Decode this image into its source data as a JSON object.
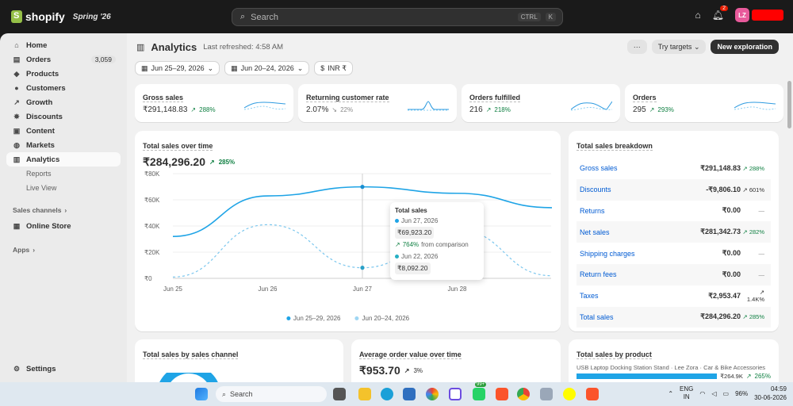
{
  "topbar": {
    "brand": "shopify",
    "edition": "Spring '26",
    "search_placeholder": "Search",
    "kbd_ctrl": "CTRL",
    "kbd_k": "K",
    "notif_count": "2",
    "avatar_initials": "LZ"
  },
  "sidebar": {
    "items": [
      {
        "label": "Home",
        "icon": "home-icon"
      },
      {
        "label": "Orders",
        "icon": "orders-icon",
        "count": "3,059"
      },
      {
        "label": "Products",
        "icon": "tag-icon"
      },
      {
        "label": "Customers",
        "icon": "person-icon"
      },
      {
        "label": "Growth",
        "icon": "growth-icon"
      },
      {
        "label": "Discounts",
        "icon": "discount-icon"
      },
      {
        "label": "Content",
        "icon": "content-icon"
      },
      {
        "label": "Markets",
        "icon": "globe-icon"
      },
      {
        "label": "Analytics",
        "icon": "chart-icon"
      }
    ],
    "subitems": [
      "Reports",
      "Live View"
    ],
    "sales_channels": "Sales channels",
    "online_store": "Online Store",
    "apps": "Apps",
    "settings": "Settings"
  },
  "header": {
    "title": "Analytics",
    "refreshed": "Last refreshed: 4:58 AM",
    "more": "···",
    "try_targets": "Try targets",
    "new_exploration": "New exploration"
  },
  "filters": {
    "date1": "Jun 25–29, 2026",
    "date2": "Jun 20–24, 2026",
    "currency": "INR ₹"
  },
  "kpis": [
    {
      "title": "Gross sales",
      "value": "₹291,148.83",
      "change": "288%",
      "trend": "up"
    },
    {
      "title": "Returning customer rate",
      "value": "2.07%",
      "change": "22%",
      "trend": "down"
    },
    {
      "title": "Orders fulfilled",
      "value": "216",
      "change": "218%",
      "trend": "up"
    },
    {
      "title": "Orders",
      "value": "295",
      "change": "293%",
      "trend": "up"
    }
  ],
  "sales_chart": {
    "title": "Total sales over time",
    "value": "₹284,296.20",
    "change": "285%",
    "tooltip": {
      "title": "Total sales",
      "date1": "Jun 27, 2026",
      "val1": "₹69,923.20",
      "comparison_change": "764%",
      "comparison_text": "from comparison",
      "date2": "Jun 22, 2026",
      "val2": "₹8,092.20"
    },
    "legend": [
      "Jun 25–29, 2026",
      "Jun 20–24, 2026"
    ]
  },
  "chart_data": {
    "type": "line",
    "x": [
      "Jun 25",
      "Jun 26",
      "Jun 27",
      "Jun 28",
      "Jun 29"
    ],
    "xticks": [
      "Jun 25",
      "Jun 26",
      "Jun 27",
      "Jun 28"
    ],
    "yticks": [
      "₹80K",
      "₹60K",
      "₹40K",
      "₹20K",
      "₹0"
    ],
    "ylim": [
      0,
      80000
    ],
    "series": [
      {
        "name": "Jun 25–29, 2026",
        "values": [
          32000,
          63000,
          69923.2,
          65000,
          54000
        ],
        "color": "#1fa4e6",
        "style": "solid"
      },
      {
        "name": "Jun 20–24, 2026",
        "values": [
          1000,
          41000,
          8092.2,
          37000,
          2000
        ],
        "color": "#7cc7ee",
        "style": "dashed"
      }
    ]
  },
  "breakdown": {
    "title": "Total sales breakdown",
    "rows": [
      {
        "label": "Gross sales",
        "amount": "₹291,148.83",
        "change": "288%",
        "dir": "up"
      },
      {
        "label": "Discounts",
        "amount": "-₹9,806.10",
        "change": "601%",
        "dir": "neutral"
      },
      {
        "label": "Returns",
        "amount": "₹0.00",
        "change": "—",
        "dir": "none"
      },
      {
        "label": "Net sales",
        "amount": "₹281,342.73",
        "change": "282%",
        "dir": "up"
      },
      {
        "label": "Shipping charges",
        "amount": "₹0.00",
        "change": "—",
        "dir": "none"
      },
      {
        "label": "Return fees",
        "amount": "₹0.00",
        "change": "—",
        "dir": "none"
      },
      {
        "label": "Taxes",
        "amount": "₹2,953.47",
        "change": "1.4K%",
        "dir": "neutral"
      },
      {
        "label": "Total sales",
        "amount": "₹284,296.20",
        "change": "285%",
        "dir": "up"
      }
    ]
  },
  "bottom_cards": {
    "channel_title": "Total sales by sales channel",
    "aov_title": "Average order value over time",
    "aov_value": "₹953.70",
    "aov_change": "3%",
    "product_title": "Total sales by product",
    "product_name": "USB Laptop Docking Station Stand · Lee Zora · Car & Bike Accessories",
    "product_value": "₹264.9K",
    "product_change": "265%"
  },
  "taskbar": {
    "search": "Search",
    "lang1": "ENG",
    "lang2": "IN",
    "battery": "96%",
    "time": "04:59",
    "date": "30-06-2026",
    "badge": "99+"
  }
}
